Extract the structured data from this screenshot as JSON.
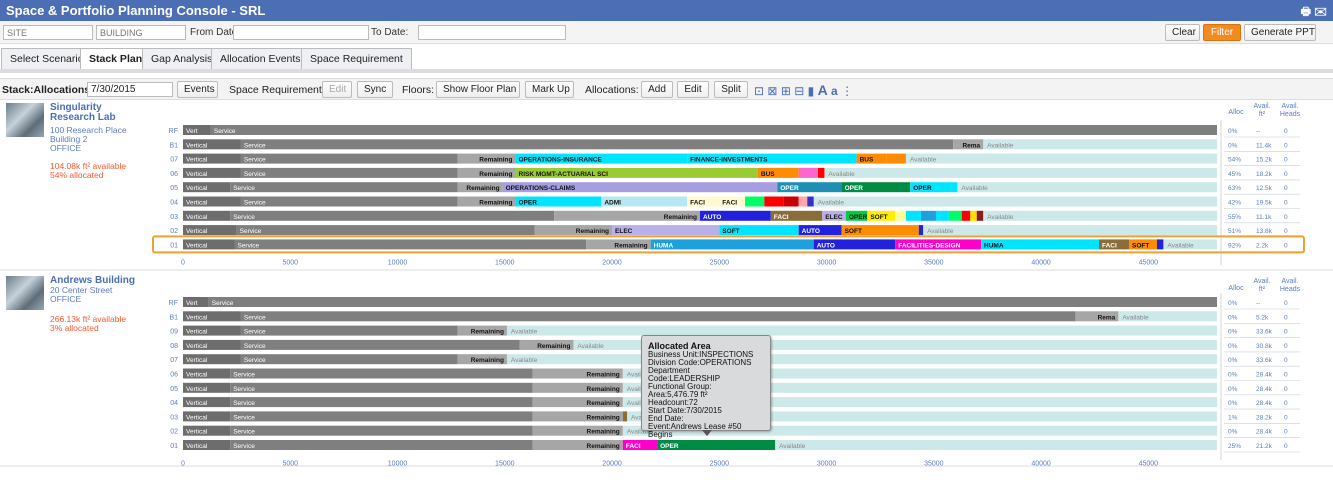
{
  "app": {
    "title": "Space & Portfolio Planning Console - SRL"
  },
  "filters": {
    "site_placeholder": "SITE",
    "building_placeholder": "BUILDING",
    "from_label": "From Date:",
    "to_label": "To Date:",
    "clear": "Clear",
    "filter": "Filter",
    "generate": "Generate PPT"
  },
  "tabs": [
    "Select Scenario",
    "Stack Plan",
    "Gap Analysis",
    "Allocation Events",
    "Space Requirement"
  ],
  "toolbar": {
    "stack_label": "Stack:Allocations as of:",
    "date": "7/30/2015",
    "events": "Events",
    "space_req": "Space Requirements:",
    "edit_disabled": "Edit",
    "sync": "Sync",
    "floors": "Floors:",
    "show_floor_plan": "Show Floor Plan",
    "markup": "Mark Up",
    "allocations": "Allocations:",
    "add": "Add",
    "edit": "Edit",
    "split": "Split"
  },
  "axis_ticks": [
    0,
    5000,
    10000,
    15000,
    20000,
    25000,
    30000,
    35000,
    40000,
    45000
  ],
  "side_headers": [
    "Alloc",
    "Avail. ft²",
    "Avail. Heads"
  ],
  "colors": {
    "vert": "#6d6d6d",
    "service": "#7f7f7f",
    "remaining": "#a6a6a6",
    "available": "#cde8e8",
    "highlight": "#f0a030",
    "accent": "#4b6eb4"
  },
  "buildings": [
    {
      "name": "Singularity Research Lab",
      "address": [
        "100 Research Place",
        "Building 2",
        "OFFICE"
      ],
      "avail": "104.08k ft² available",
      "alloc": "54% allocated",
      "floors": [
        {
          "label": "RF",
          "vert": "Vert",
          "service": "Service",
          "end": 48200,
          "segs": [
            [
              0,
              1300,
              "#6d6d6d",
              "Vert"
            ],
            [
              1300,
              48200,
              "#7f7f7f",
              "Service"
            ]
          ],
          "alloc": "0%",
          "ft": "--",
          "heads": "0"
        },
        {
          "label": "B1",
          "vert": "Vertical",
          "service": "Service",
          "end": 48200,
          "segs": [
            [
              0,
              2700,
              "#6d6d6d",
              "Vertical"
            ],
            [
              2700,
              35900,
              "#7f7f7f",
              "Service"
            ],
            [
              35900,
              37300,
              "#a6a6a6",
              "Rema"
            ]
          ],
          "avail_start": 37300,
          "alloc": "0%",
          "ft": "11.4k",
          "heads": "0"
        },
        {
          "label": "07",
          "end": 48200,
          "segs": [
            [
              0,
              2700,
              "#6d6d6d",
              "Vertical"
            ],
            [
              2700,
              12800,
              "#7f7f7f",
              "Service"
            ],
            [
              12800,
              15500,
              "#a6a6a6",
              "Remaining"
            ],
            [
              15500,
              23500,
              "#00e5ff",
              "OPERATIONS-INSURANCE"
            ],
            [
              23500,
              31400,
              "#00e5ff",
              "FINANCE-INVESTMENTS"
            ],
            [
              31400,
              32800,
              "#ff8c00",
              "BUS"
            ],
            [
              32800,
              33700,
              "#ff8c00",
              ""
            ]
          ],
          "avail_start": 33700,
          "alloc": "54%",
          "ft": "15.2k",
          "heads": "0"
        },
        {
          "label": "06",
          "end": 48200,
          "segs": [
            [
              0,
              2700,
              "#6d6d6d",
              "Vertical"
            ],
            [
              2700,
              12800,
              "#7f7f7f",
              "Service"
            ],
            [
              12800,
              15500,
              "#a6a6a6",
              "Remaining"
            ],
            [
              15500,
              26800,
              "#99cc33",
              "RISK MGMT-ACTUARIAL SCI"
            ],
            [
              26800,
              28700,
              "#ff8c00",
              "BUS"
            ],
            [
              28700,
              29600,
              "#ff66cc",
              ""
            ],
            [
              29600,
              29900,
              "#ff0000",
              ""
            ]
          ],
          "avail_start": 29900,
          "alloc": "45%",
          "ft": "18.2k",
          "heads": "0"
        },
        {
          "label": "05",
          "end": 48200,
          "segs": [
            [
              0,
              2200,
              "#6d6d6d",
              "Vertical"
            ],
            [
              2200,
              12800,
              "#7f7f7f",
              "Service"
            ],
            [
              12800,
              14900,
              "#a6a6a6",
              "Remaining"
            ],
            [
              14900,
              27700,
              "#a59ee0",
              "OPERATIONS-CLAIMS"
            ],
            [
              27700,
              30700,
              "#1e90b4",
              "OPER"
            ],
            [
              30700,
              33900,
              "#008b45",
              "OPER"
            ],
            [
              33900,
              36100,
              "#00e5ff",
              "OPER"
            ]
          ],
          "avail_start": 36100,
          "alloc": "63%",
          "ft": "12.5k",
          "heads": "0"
        },
        {
          "label": "04",
          "end": 48200,
          "segs": [
            [
              0,
              2700,
              "#6d6d6d",
              "Vertical"
            ],
            [
              2700,
              12800,
              "#7f7f7f",
              "Service"
            ],
            [
              12800,
              15500,
              "#a6a6a6",
              "Remaining"
            ],
            [
              15500,
              19500,
              "#00e5ff",
              "OPER"
            ],
            [
              19500,
              23500,
              "#b5e8f2",
              "ADMI"
            ],
            [
              23500,
              25000,
              "#fff8d0",
              "FACI"
            ],
            [
              25000,
              26200,
              "#fff8d0",
              "FACI"
            ],
            [
              26200,
              27100,
              "#00ff66",
              ""
            ],
            [
              27100,
              28000,
              "#ff0000",
              ""
            ],
            [
              28000,
              28700,
              "#cc0000",
              ""
            ],
            [
              28700,
              29100,
              "#ffaaaa",
              ""
            ],
            [
              29100,
              29400,
              "#3333cc",
              ""
            ]
          ],
          "avail_start": 29400,
          "alloc": "42%",
          "ft": "19.5k",
          "heads": "0"
        },
        {
          "label": "03",
          "end": 48200,
          "segs": [
            [
              0,
              2200,
              "#6d6d6d",
              "Vertical"
            ],
            [
              2200,
              17300,
              "#7f7f7f",
              "Service"
            ],
            [
              17300,
              24100,
              "#a6a6a6",
              "Remaining"
            ],
            [
              24100,
              27400,
              "#2222dd",
              "AUTO"
            ],
            [
              27400,
              29800,
              "#8b6d3a",
              "FACI"
            ],
            [
              29800,
              30900,
              "#b8b0e8",
              "ELEC"
            ],
            [
              30900,
              31900,
              "#00cc44",
              "OPER"
            ],
            [
              31900,
              33200,
              "#ffee00",
              "SOFT"
            ],
            [
              33200,
              33700,
              "#ffff99",
              ""
            ],
            [
              33700,
              34400,
              "#00e5ff",
              ""
            ],
            [
              34400,
              35100,
              "#1ea0dc",
              ""
            ],
            [
              35100,
              35700,
              "#00e5ff",
              ""
            ],
            [
              35700,
              36300,
              "#00ff66",
              ""
            ],
            [
              36300,
              36700,
              "#ff0000",
              ""
            ],
            [
              36700,
              37000,
              "#ffdd00",
              ""
            ],
            [
              37000,
              37300,
              "#8b1a1a",
              ""
            ]
          ],
          "avail_start": 37300,
          "alloc": "55%",
          "ft": "11.1k",
          "heads": "0"
        },
        {
          "label": "02",
          "end": 48200,
          "segs": [
            [
              0,
              2500,
              "#6d6d6d",
              "Vertical"
            ],
            [
              2500,
              16400,
              "#7f7f7f",
              "Service"
            ],
            [
              16400,
              20000,
              "#a6a6a6",
              "Remaining"
            ],
            [
              20000,
              25000,
              "#b8b0e8",
              "ELEC"
            ],
            [
              25000,
              28700,
              "#00e5ff",
              "SOFT"
            ],
            [
              28700,
              30700,
              "#2222dd",
              "AUTO"
            ],
            [
              30700,
              34300,
              "#ff8c00",
              "SOFT"
            ],
            [
              34300,
              34500,
              "#2222dd",
              ""
            ]
          ],
          "avail_start": 34500,
          "alloc": "51%",
          "ft": "13.8k",
          "heads": "0"
        },
        {
          "label": "01",
          "highlight": true,
          "end": 48200,
          "segs": [
            [
              0,
              2400,
              "#6d6d6d",
              "Vertical"
            ],
            [
              2400,
              18800,
              "#7f7f7f",
              "Service"
            ],
            [
              18800,
              21800,
              "#a6a6a6",
              "Remaining"
            ],
            [
              21800,
              29400,
              "#1ea0dc",
              "HUMA"
            ],
            [
              29400,
              33200,
              "#2222dd",
              "AUTO"
            ],
            [
              33200,
              37200,
              "#ff00cc",
              "FACILITIES-DESIGN"
            ],
            [
              37200,
              42700,
              "#00e5ff",
              "HUMA"
            ],
            [
              42700,
              44100,
              "#8b6d3a",
              "FACI"
            ],
            [
              44100,
              45400,
              "#ff8c00",
              "SOFT"
            ],
            [
              45400,
              45700,
              "#2222dd",
              ""
            ]
          ],
          "avail_start": 45700,
          "alloc": "92%",
          "ft": "2.2k",
          "heads": "0"
        }
      ]
    },
    {
      "name": "Andrews Building",
      "address": [
        "20 Center Street",
        "OFFICE"
      ],
      "avail": "266.13k ft² available",
      "alloc": "3% allocated",
      "floors": [
        {
          "label": "RF",
          "end": 48200,
          "segs": [
            [
              0,
              1200,
              "#6d6d6d",
              "Vert"
            ],
            [
              1200,
              48200,
              "#7f7f7f",
              "Service"
            ]
          ],
          "alloc": "0%",
          "ft": "--",
          "heads": "0"
        },
        {
          "label": "B1",
          "end": 48200,
          "segs": [
            [
              0,
              2700,
              "#6d6d6d",
              "Vertical"
            ],
            [
              2700,
              41600,
              "#7f7f7f",
              "Service"
            ],
            [
              41600,
              43600,
              "#a6a6a6",
              "Rema"
            ]
          ],
          "avail_start": 43600,
          "alloc": "0%",
          "ft": "5.2k",
          "heads": "0"
        },
        {
          "label": "09",
          "end": 48200,
          "segs": [
            [
              0,
              2700,
              "#6d6d6d",
              "Vertical"
            ],
            [
              2700,
              12800,
              "#7f7f7f",
              "Service"
            ],
            [
              12800,
              15100,
              "#a6a6a6",
              "Remaining"
            ]
          ],
          "avail_start": 15100,
          "alloc": "0%",
          "ft": "33.6k",
          "heads": "0"
        },
        {
          "label": "08",
          "end": 48200,
          "segs": [
            [
              0,
              2700,
              "#6d6d6d",
              "Vertical"
            ],
            [
              2700,
              15700,
              "#7f7f7f",
              "Service"
            ],
            [
              15700,
              18200,
              "#a6a6a6",
              "Remaining"
            ]
          ],
          "avail_start": 18200,
          "alloc": "0%",
          "ft": "30.8k",
          "heads": "0"
        },
        {
          "label": "07",
          "end": 48200,
          "segs": [
            [
              0,
              2700,
              "#6d6d6d",
              "Vertical"
            ],
            [
              2700,
              12800,
              "#7f7f7f",
              "Service"
            ],
            [
              12800,
              15100,
              "#a6a6a6",
              "Remaining"
            ]
          ],
          "avail_start": 15100,
          "alloc": "0%",
          "ft": "33.6k",
          "heads": "0"
        },
        {
          "label": "06",
          "end": 48200,
          "segs": [
            [
              0,
              2200,
              "#6d6d6d",
              "Vertical"
            ],
            [
              2200,
              16300,
              "#7f7f7f",
              "Service"
            ],
            [
              16300,
              20500,
              "#a6a6a6",
              "Remaining"
            ]
          ],
          "avail_start": 20500,
          "alloc": "0%",
          "ft": "28.4k",
          "heads": "0"
        },
        {
          "label": "05",
          "end": 48200,
          "segs": [
            [
              0,
              2200,
              "#6d6d6d",
              "Vertical"
            ],
            [
              2200,
              16300,
              "#7f7f7f",
              "Service"
            ],
            [
              16300,
              20500,
              "#a6a6a6",
              "Remaining"
            ]
          ],
          "avail_start": 20500,
          "alloc": "0%",
          "ft": "28.4k",
          "heads": "0"
        },
        {
          "label": "04",
          "end": 48200,
          "segs": [
            [
              0,
              2200,
              "#6d6d6d",
              "Vertical"
            ],
            [
              2200,
              16300,
              "#7f7f7f",
              "Service"
            ],
            [
              16300,
              20500,
              "#a6a6a6",
              "Remaining"
            ]
          ],
          "avail_start": 20500,
          "alloc": "0%",
          "ft": "28.4k",
          "heads": "0"
        },
        {
          "label": "03",
          "end": 48200,
          "segs": [
            [
              0,
              2200,
              "#6d6d6d",
              "Vertical"
            ],
            [
              2200,
              16300,
              "#7f7f7f",
              "Service"
            ],
            [
              16300,
              20500,
              "#a6a6a6",
              "Remaining"
            ],
            [
              20500,
              20700,
              "#8b6d3a",
              ""
            ]
          ],
          "avail_start": 20700,
          "alloc": "1%",
          "ft": "28.2k",
          "heads": "0"
        },
        {
          "label": "02",
          "end": 48200,
          "segs": [
            [
              0,
              2200,
              "#6d6d6d",
              "Vertical"
            ],
            [
              2200,
              16300,
              "#7f7f7f",
              "Service"
            ],
            [
              16300,
              20500,
              "#a6a6a6",
              "Remaining"
            ]
          ],
          "avail_start": 20500,
          "alloc": "0%",
          "ft": "28.4k",
          "heads": "0"
        },
        {
          "label": "01",
          "end": 48200,
          "segs": [
            [
              0,
              2200,
              "#6d6d6d",
              "Vertical"
            ],
            [
              2200,
              16300,
              "#7f7f7f",
              "Service"
            ],
            [
              16300,
              20500,
              "#a6a6a6",
              "Remaining"
            ],
            [
              20500,
              22100,
              "#ff00cc",
              "FACI"
            ],
            [
              22100,
              27600,
              "#008b45",
              "OPER"
            ]
          ],
          "avail_start": 27600,
          "alloc": "25%",
          "ft": "21.2k",
          "heads": "0"
        }
      ]
    }
  ],
  "available_label": "Available",
  "tooltip": {
    "title": "Allocated Area",
    "lines": [
      "Business Unit:INSPECTIONS",
      "Division Code:OPERATIONS",
      "Department Code:LEADERSHIP",
      "Functional Group:",
      "Area:5,476.79 ft²",
      "Headcount:72",
      "Start Date:7/30/2015",
      "End Date:",
      "Event:Andrews Lease #50 Begins"
    ]
  }
}
